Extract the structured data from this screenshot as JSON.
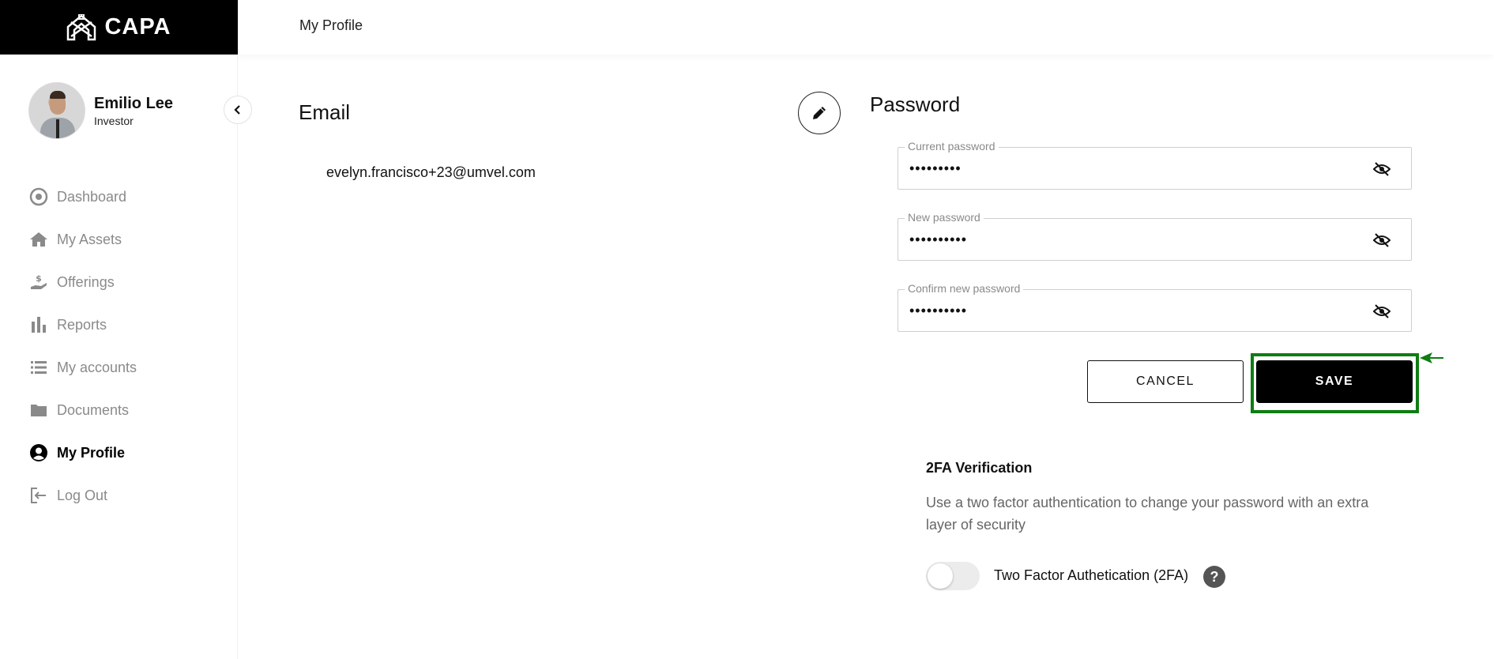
{
  "app": {
    "logo_text": "CAPA"
  },
  "header": {
    "title": "My Profile"
  },
  "user": {
    "name": "Emilio Lee",
    "role": "Investor"
  },
  "sidebar": {
    "items": [
      {
        "label": "Dashboard",
        "icon": "dashboard-icon",
        "active": false
      },
      {
        "label": "My Assets",
        "icon": "home-icon",
        "active": false
      },
      {
        "label": "Offerings",
        "icon": "offerings-hand-dollar-icon",
        "active": false
      },
      {
        "label": "Reports",
        "icon": "bar-chart-icon",
        "active": false
      },
      {
        "label": "My accounts",
        "icon": "list-icon",
        "active": false
      },
      {
        "label": "Documents",
        "icon": "folder-icon",
        "active": false
      },
      {
        "label": "My Profile",
        "icon": "user-circle-icon",
        "active": true
      },
      {
        "label": "Log Out",
        "icon": "logout-icon",
        "active": false
      }
    ]
  },
  "email": {
    "title": "Email",
    "value": "evelyn.francisco+23@umvel.com"
  },
  "password": {
    "title": "Password",
    "fields": [
      {
        "label": "Current password",
        "value": "•••••••••"
      },
      {
        "label": "New password",
        "value": "••••••••••"
      },
      {
        "label": "Confirm new password",
        "value": "••••••••••"
      }
    ],
    "cancel_label": "CANCEL",
    "save_label": "SAVE"
  },
  "tfa": {
    "title": "2FA Verification",
    "description": "Use a two factor authentication to change your password with an extra layer of security",
    "toggle_label": "Two Factor Authetication (2FA)",
    "enabled": false,
    "help_glyph": "?"
  },
  "colors": {
    "brand_black": "#000000",
    "highlight_green": "#0f7d12",
    "nav_inactive": "#8a8a8a"
  }
}
